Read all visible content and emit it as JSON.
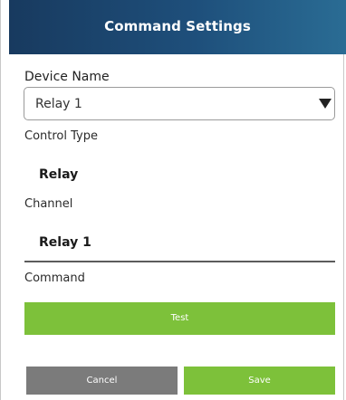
{
  "header": {
    "title": "Command Settings"
  },
  "form": {
    "device_name_label": "Device Name",
    "device_name_value": "Relay 1",
    "control_type_label": "Control Type",
    "control_type_value": "Relay",
    "channel_label": "Channel",
    "channel_value": "Relay 1",
    "command_label": "Command"
  },
  "buttons": {
    "test": "Test",
    "cancel": "Cancel",
    "save": "Save"
  },
  "icons": {
    "dropdown": "triangle-down-icon"
  },
  "colors": {
    "header_gradient_start": "#183a5f",
    "header_gradient_end": "#2a6c94",
    "accent_green": "#7dc13a",
    "cancel_gray": "#7b7b7b"
  }
}
